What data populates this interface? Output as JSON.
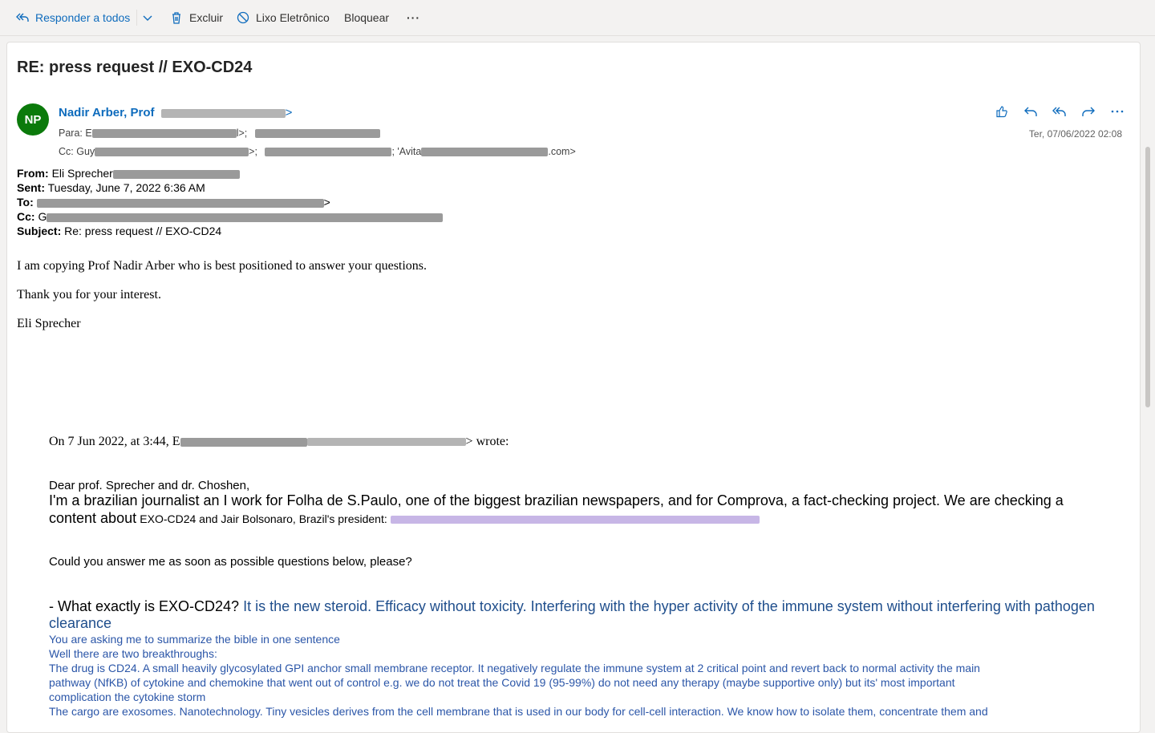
{
  "toolbar": {
    "reply_all": "Responder a todos",
    "delete": "Excluir",
    "junk": "Lixo Eletrônico",
    "block": "Bloquear",
    "more": "···"
  },
  "message": {
    "subject": "RE: press request // EXO-CD24",
    "avatar_initials": "NP",
    "avatar_color": "#0b7a0b",
    "sender_name": "Nadir Arber, Prof",
    "to_label": "Para:",
    "to_prefix": "E",
    "to_suffix": "l>;",
    "cc_label": "Cc:",
    "cc_prefix": "Guy",
    "cc_suffix1": ">;",
    "cc_suffix2": ";",
    "cc_avita": "'Avita",
    "cc_end": ".com>",
    "date": "Ter, 07/06/2022 02:08"
  },
  "forward_header": {
    "from_label": "From:",
    "from_value": "Eli Sprecher",
    "sent_label": "Sent:",
    "sent_value": "Tuesday, June 7, 2022 6:36 AM",
    "to_label": "To:",
    "to_end": ">",
    "cc_label": "Cc:",
    "cc_value": "G",
    "subject_label": "Subject:",
    "subject_value": "Re: press request // EXO-CD24"
  },
  "body": {
    "line1": "I am copying Prof Nadir Arber who is best positioned to answer your questions.",
    "line2": "Thank you for your interest.",
    "signature": "Eli Sprecher"
  },
  "quoted": {
    "intro_start": "On 7 Jun 2022, at 3:44, E",
    "intro_end": "> wrote:",
    "greeting": "Dear prof. Sprecher and dr. Choshen,",
    "p1": "I'm a brazilian journalist an I work for Folha de S.Paulo, one of the biggest brazilian newspapers, and for Comprova, a fact-checking project. We are checking a",
    "p1b_big": "content about",
    "p1b_small": "EXO-CD24 and Jair Bolsonaro, Brazil's president:",
    "question_intro": "Could you answer me as soon as possible questions below, please?",
    "q1": "- What exactly is EXO-CD24?",
    "a1": "It is the new steroid. Efficacy without toxicity. Interfering with the hyper activity of the immune system without interfering with pathogen",
    "a1b": "clearance",
    "a2": "You are asking me to summarize the bible in one sentence",
    "a3": "Well there are two breakthroughs:",
    "a4": "The drug is CD24. A small heavily glycosylated GPI anchor small membrane receptor. It negatively regulate the immune system at 2 critical point and revert back to normal activity the main",
    "a5": "pathway (NfKB) of cytokine and chemokine that went out of control e.g. we do not treat the Covid 19 (95-99%) do not need any therapy (maybe supportive only) but its' most important",
    "a6": "complication the cytokine storm",
    "a7": "The cargo are exosomes. Nanotechnology. Tiny vesicles derives from the cell membrane that is used in our body for cell-cell interaction. We know how to isolate them, concentrate them and"
  }
}
